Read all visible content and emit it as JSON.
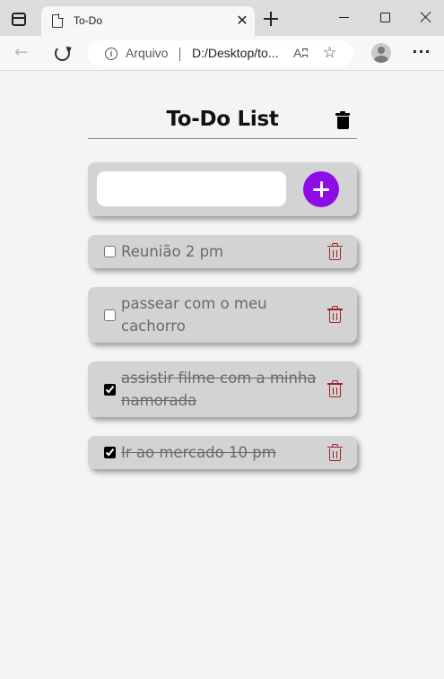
{
  "browser": {
    "tab": {
      "title": "To-Do",
      "close_glyph": "✕"
    },
    "address": {
      "origin_label": "Arquivo",
      "url": "D:/Desktop/to...",
      "read_aloud_glyph": "Aʭ"
    },
    "icons": {
      "tab_actions": "tab-actions-icon",
      "favicon": "page-icon",
      "new_tab": "plus-icon",
      "back": "arrow-left-icon",
      "reload": "reload-icon",
      "info": "info-icon",
      "read_aloud": "read-aloud-icon",
      "favorites": "star-add-icon",
      "profile": "profile-icon",
      "more": "more-icon"
    },
    "back_glyph": "←",
    "info_glyph": "i",
    "favorites_glyph": "☆",
    "more_glyph": "···"
  },
  "app": {
    "title": "To-Do List",
    "input": {
      "value": "",
      "placeholder": ""
    },
    "add_button_color": "#8e0ce6",
    "delete_color": "#a0202a",
    "tasks": [
      {
        "text": "Reunião 2 pm",
        "done": false
      },
      {
        "text": "passear com o meu cachorro",
        "done": false
      },
      {
        "text": "assistir filme com a minha namorada",
        "done": true
      },
      {
        "text": "Ir ao mercado 10 pm",
        "done": true
      }
    ]
  }
}
